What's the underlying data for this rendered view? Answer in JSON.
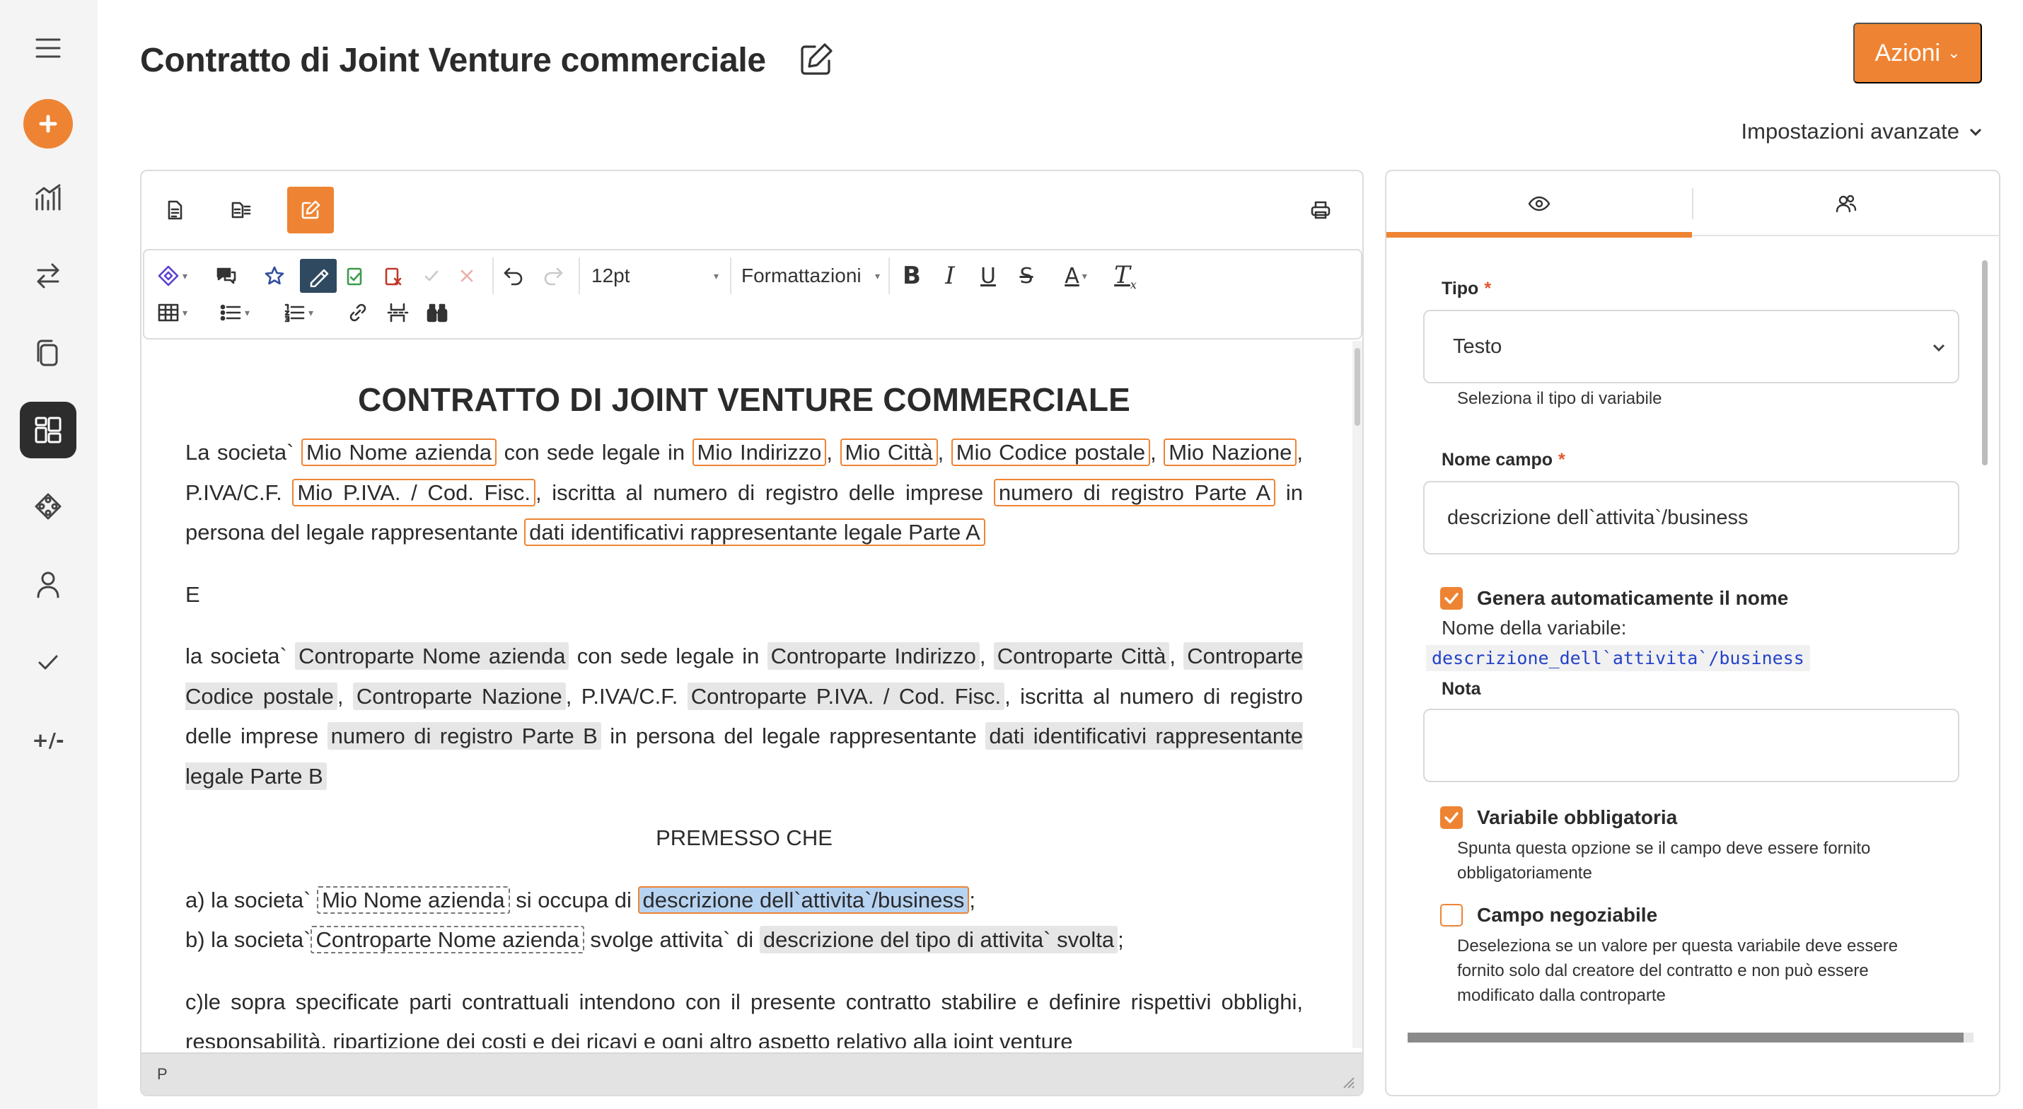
{
  "header": {
    "title": "Contratto di Joint Venture commerciale",
    "actions_label": "Azioni",
    "advanced_label": "Impostazioni avanzate"
  },
  "sidebar": {
    "icons": [
      "menu-icon",
      "add-icon",
      "chart-icon",
      "swap-icon",
      "documents-icon",
      "templates-icon",
      "puzzle-icon",
      "user-icon",
      "check-icon"
    ],
    "diff_label": "+/-"
  },
  "toolbar": {
    "font_size": "12pt",
    "format_label": "Formattazioni"
  },
  "document": {
    "title": "CONTRATTO DI JOINT VENTURE COMMERCIALE",
    "p1": {
      "t1": "La societa`",
      "v1": "Mio Nome azienda",
      "t2": "con sede legale in",
      "v2": "Mio Indirizzo",
      "t3": ",",
      "v3": "Mio Città",
      "t4": ",",
      "v4": "Mio Codice postale",
      "t5": ",",
      "v5": "Mio Nazione",
      "t6": ", P.IVA/C.F.",
      "v6": "Mio P.IVA. / Cod. Fisc.",
      "t7": ", iscritta al numero di registro delle imprese",
      "v7": "numero di registro Parte A",
      "t8": "in persona del legale rappresentante",
      "v8": "dati identificativi rappresentante legale Parte A"
    },
    "p2": "E",
    "p3": {
      "t1": "la societa`",
      "v1": "Controparte Nome azienda",
      "t2": "con sede legale in",
      "v2": "Controparte Indirizzo",
      "t3": ",",
      "v3": "Controparte Città",
      "t4": ",",
      "v4": "Controparte Codice postale",
      "t5": ",",
      "v5": "Controparte Nazione",
      "t6": ", P.IVA/C.F.",
      "v6": "Controparte P.IVA. / Cod. Fisc.",
      "t7": ", iscritta al numero di registro delle imprese",
      "v7": "numero di registro Parte B",
      "t8": "in persona del legale rappresentante",
      "v8": "dati identificativi rappresentante legale Parte B"
    },
    "premesso": "PREMESSO CHE",
    "a": {
      "t1": "a) la societa`",
      "v1": "Mio Nome azienda",
      "t2": "si occupa di",
      "v2": "descrizione dell`attivita`/business",
      "t3": ";"
    },
    "b": {
      "t1": "b) la societa`",
      "v1": "Controparte Nome azienda",
      "t2": "svolge attivita` di",
      "v2": "descrizione del tipo di attivita` svolta",
      "t3": ";"
    },
    "c": "c)le sopra specificate parti contrattuali intendono con il presente contratto stabilire e definire rispettivi obblighi, responsabilità, ripartizione dei costi e dei ricavi e ogni altro aspetto relativo alla joint venture",
    "status_path": "P"
  },
  "panel": {
    "tipo_label": "Tipo",
    "tipo_value": "Testo",
    "tipo_hint": "Seleziona il tipo di variabile",
    "nome_label": "Nome campo",
    "nome_value": "descrizione dell`attivita`/business",
    "genera_label": "Genera automaticamente il nome",
    "nome_var_label": "Nome della variabile:",
    "nome_var_value": "descrizione_dell`attivita`/business",
    "nota_label": "Nota",
    "nota_value": "",
    "obbligatoria_label": "Variabile obbligatoria",
    "obbligatoria_hint": "Spunta questa opzione se il campo deve essere fornito obbligatoriamente",
    "negoziabile_label": "Campo negoziabile",
    "negoziabile_hint": "Deseleziona se un valore per questa variabile deve essere fornito solo dal creatore del contratto e non può essere modificato dalla controparte",
    "genera_checked": true,
    "obbligatoria_checked": true,
    "negoziabile_checked": false
  },
  "colors": {
    "accent": "#ee8433",
    "sidebar_bg": "#f4f4f4",
    "selection": "#b7d3f2",
    "code_text": "#2342c8"
  }
}
